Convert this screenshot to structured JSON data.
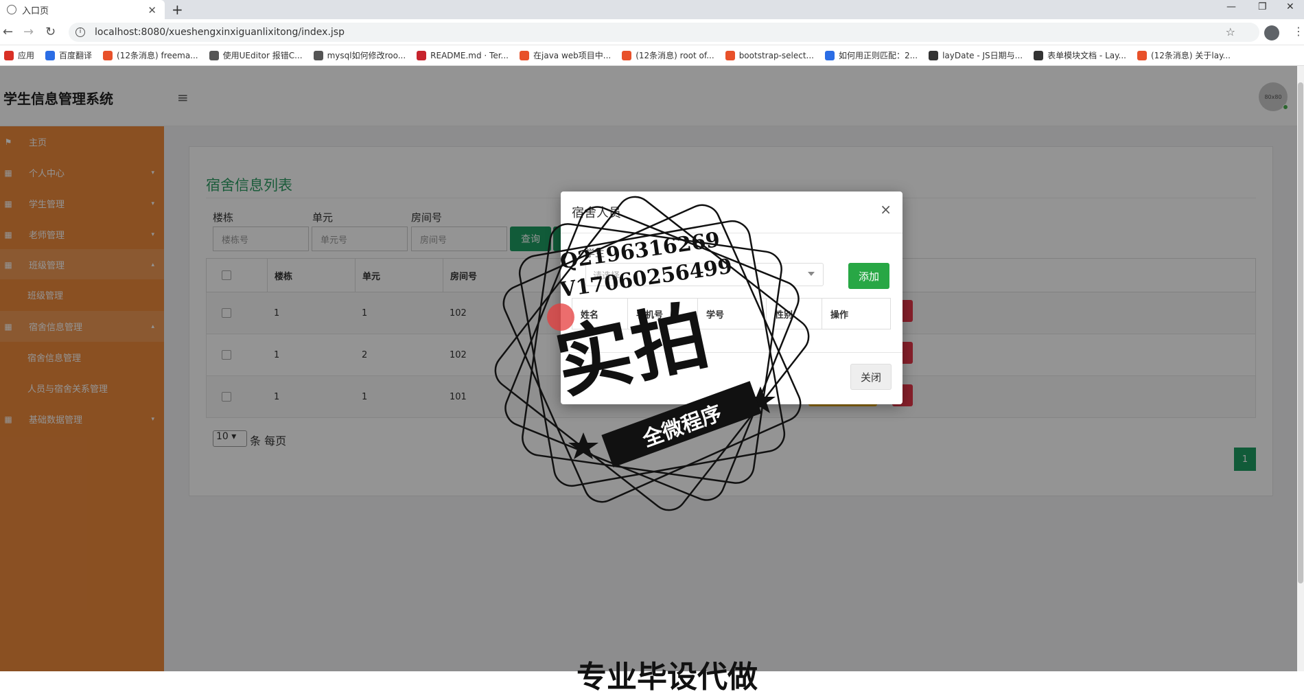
{
  "browser": {
    "tab_title": "入口页",
    "tab_close": "✕",
    "newtab": "+",
    "back": "←",
    "forward": "→",
    "reload": "↻",
    "url": "localhost:8080/xueshengxinxiguanlixitong/index.jsp",
    "star": "☆",
    "menu": "⋮",
    "minimize": "—",
    "restore": "❐",
    "close": "✕",
    "bookmarks": [
      {
        "label": "应用",
        "color": "#d93025"
      },
      {
        "label": "百度翻译",
        "color": "#2b6de5"
      },
      {
        "label": "(12条消息) freema...",
        "color": "#e8512a"
      },
      {
        "label": "使用UEditor 报错C...",
        "color": "#555555"
      },
      {
        "label": "mysql如何修改roo...",
        "color": "#555555"
      },
      {
        "label": "README.md · Ter...",
        "color": "#c7242d"
      },
      {
        "label": "在java web项目中...",
        "color": "#e8512a"
      },
      {
        "label": "(12条消息) root of...",
        "color": "#e8512a"
      },
      {
        "label": "bootstrap-select...",
        "color": "#e8512a"
      },
      {
        "label": "如何用正则匹配：2...",
        "color": "#2b6de5"
      },
      {
        "label": "layDate - JS日期与...",
        "color": "#333333"
      },
      {
        "label": "表单模块文档 - Lay...",
        "color": "#333333"
      },
      {
        "label": "(12条消息) 关于lay...",
        "color": "#e8512a"
      }
    ]
  },
  "app": {
    "title": "学生信息管理系统",
    "hamburger": "≡",
    "avatar_text": "80x80"
  },
  "sidebar": {
    "items": [
      {
        "label": "主页",
        "icon": "⚑",
        "caret": ""
      },
      {
        "label": "个人中心",
        "icon": "▦",
        "caret": "▾"
      },
      {
        "label": "学生管理",
        "icon": "▦",
        "caret": "▾"
      },
      {
        "label": "老师管理",
        "icon": "▦",
        "caret": "▾"
      },
      {
        "label": "班级管理",
        "icon": "▦",
        "caret": "▴"
      },
      {
        "label": "宿舍信息管理",
        "icon": "▦",
        "caret": "▴"
      },
      {
        "label": "基础数据管理",
        "icon": "▦",
        "caret": "▾"
      }
    ],
    "sub_class": "班级管理",
    "sub_dorm_1": "宿舍信息管理",
    "sub_dorm_2": "人员与宿舍关系管理"
  },
  "panel": {
    "title": "宿舍信息列表",
    "filters": [
      {
        "label": "楼栋",
        "placeholder": "楼栋号"
      },
      {
        "label": "单元",
        "placeholder": "单元号"
      },
      {
        "label": "房间号",
        "placeholder": "房间号"
      }
    ],
    "search_btn": "查询",
    "columns": [
      "楼栋",
      "单元",
      "房间号"
    ],
    "rows": [
      {
        "building": "1",
        "unit": "1",
        "room": "102"
      },
      {
        "building": "1",
        "unit": "2",
        "room": "102"
      },
      {
        "building": "1",
        "unit": "1",
        "room": "101"
      }
    ],
    "page_size": "10",
    "page_size_label": "条 每页",
    "page_num": "1"
  },
  "modal": {
    "title": "宿舍人员",
    "close_x": "×",
    "student_label": "学生",
    "select_placeholder": "请选择",
    "add_btn": "添加",
    "columns": [
      "姓名",
      "手机号",
      "学号",
      "性别",
      "操作"
    ],
    "close_btn": "关闭"
  },
  "watermark": {
    "phone_q": "Q2196316269",
    "phone_v": "V17060256499",
    "big": "实拍",
    "banner": "全微程序",
    "bottom": "专业毕设代做"
  }
}
